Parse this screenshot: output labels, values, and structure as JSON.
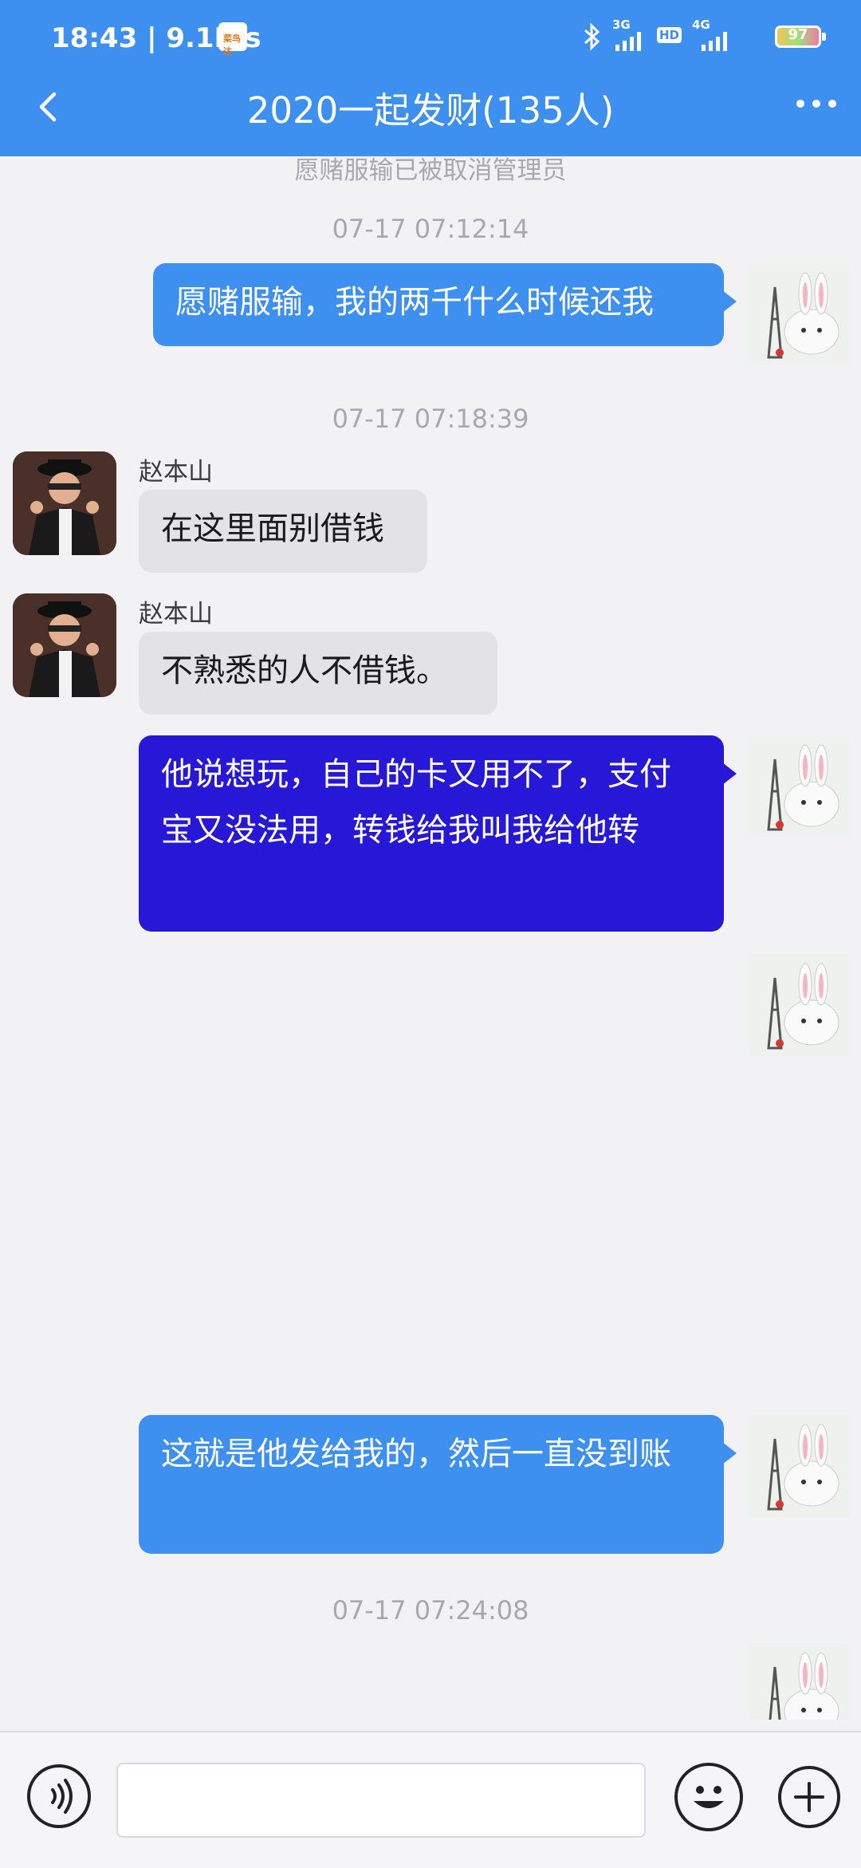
{
  "status_bar": {
    "time_speed": "18:43 | 9.1K/s",
    "app_badge_text": "菜鸟达",
    "net1": "3G",
    "net2": "HD",
    "net3": "4G",
    "battery": "97"
  },
  "nav": {
    "title": "2020一起发财(135人)"
  },
  "system_note": "愿赌服输已被取消管理员",
  "messages": {
    "ts1": "07-17 07:12:14",
    "m1": "愿赌服输，我的两千什么时候还我",
    "ts2": "07-17 07:18:39",
    "m2_sender": "赵本山",
    "m2": "在这里面别借钱",
    "m3_sender": "赵本山",
    "m3": "不熟悉的人不借钱。",
    "m4": "他说想玩，自己的卡又用不了，支付宝又没法用，转钱给我叫我给他转",
    "m6": "这就是他发给我的，然后一直没到账",
    "ts3": "07-17 07:24:08"
  },
  "input_bar": {
    "placeholder": ""
  },
  "colors": {
    "header": "#3d8ff0",
    "bubble_out": "#3d8ff0",
    "bubble_selected": "#2618d6",
    "bubble_in": "#e3e3e6"
  }
}
